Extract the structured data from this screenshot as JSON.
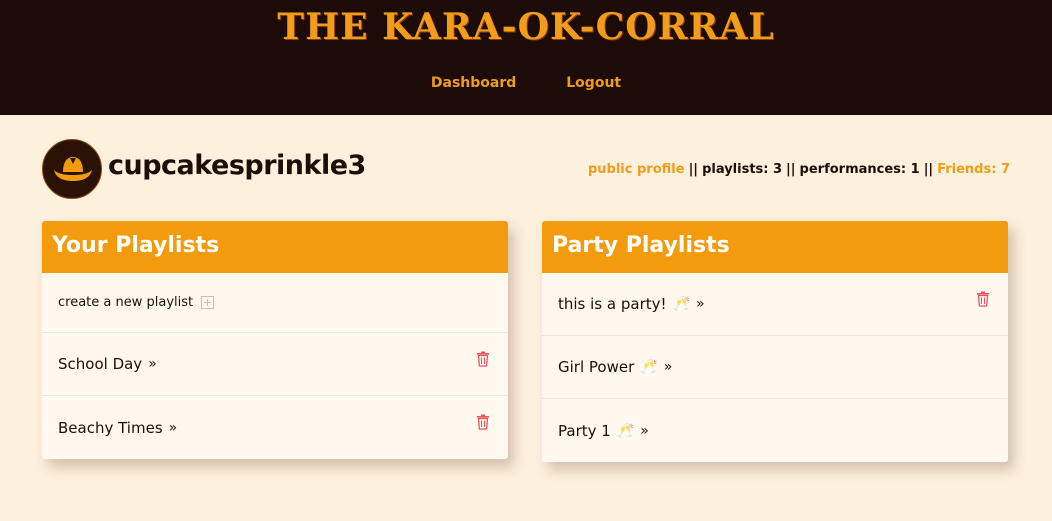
{
  "header": {
    "site_title": "THE KARA-OK-CORRAL",
    "nav": {
      "dashboard": "Dashboard",
      "logout": "Logout"
    }
  },
  "profile": {
    "username": "cupcakesprinkle3",
    "avatar_icon": "cowboy-hat-icon",
    "public_profile": "public profile",
    "sep": "||",
    "playlists": "playlists: 3",
    "performances": "performances: 1",
    "friends": "Friends: 7"
  },
  "your_playlists": {
    "title": "Your Playlists",
    "create_label": "create a new playlist",
    "items": [
      {
        "name": "School Day"
      },
      {
        "name": "Beachy Times"
      }
    ]
  },
  "party_playlists": {
    "title": "Party Playlists",
    "items": [
      {
        "name": "this is a party!"
      },
      {
        "name": "Girl Power"
      },
      {
        "name": "Party 1"
      }
    ]
  },
  "glyphs": {
    "raquo": "»",
    "toast": "🥂"
  },
  "colors": {
    "accent": "#f29b0d",
    "dark": "#1c0b06",
    "background": "#fdf0dc",
    "trash": "#e8545c"
  }
}
